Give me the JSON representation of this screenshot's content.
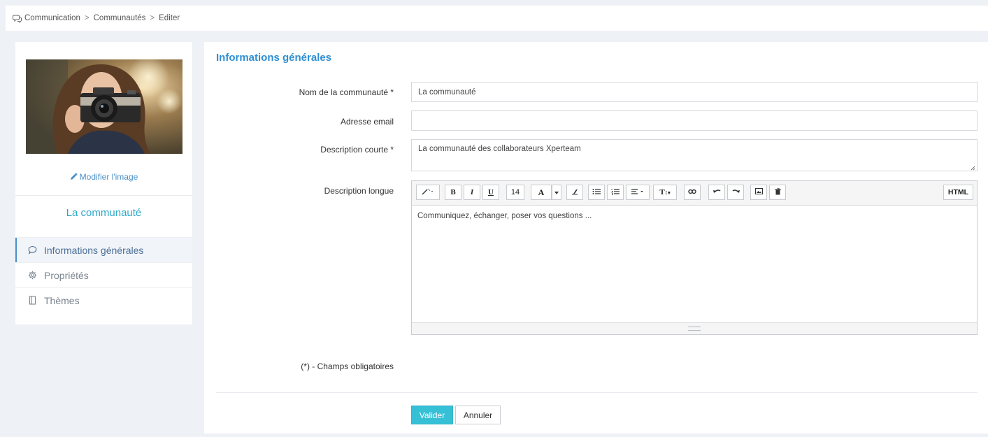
{
  "breadcrumb": {
    "icon": "chat-icon",
    "items": [
      "Communication",
      "Communautés",
      "Editer"
    ],
    "separator": ">"
  },
  "sidebar": {
    "edit_image_label": "Modifier l'image",
    "community_name": "La communauté",
    "nav": [
      {
        "label": "Informations générales",
        "icon": "chat-bubble-icon",
        "active": true
      },
      {
        "label": "Propriétés",
        "icon": "gear-icon",
        "active": false
      },
      {
        "label": "Thèmes",
        "icon": "book-icon",
        "active": false
      }
    ]
  },
  "form": {
    "section_title": "Informations générales",
    "fields": {
      "name": {
        "label": "Nom de la communauté *",
        "value": "La communauté"
      },
      "email": {
        "label": "Adresse email",
        "value": ""
      },
      "short_desc": {
        "label": "Description courte *",
        "value": "La communauté des collaborateurs Xperteam"
      },
      "long_desc": {
        "label": "Description longue",
        "value": "Communiquez, échanger, poser vos questions ..."
      }
    },
    "toolbar": {
      "font_size": "14",
      "html_label": "HTML"
    },
    "required_note": "(*) - Champs obligatoires",
    "submit_label": "Valider",
    "cancel_label": "Annuler"
  },
  "colors": {
    "accent": "#2f8fd2",
    "primary_button": "#35c0d6",
    "community_name": "#2ea8c9"
  }
}
